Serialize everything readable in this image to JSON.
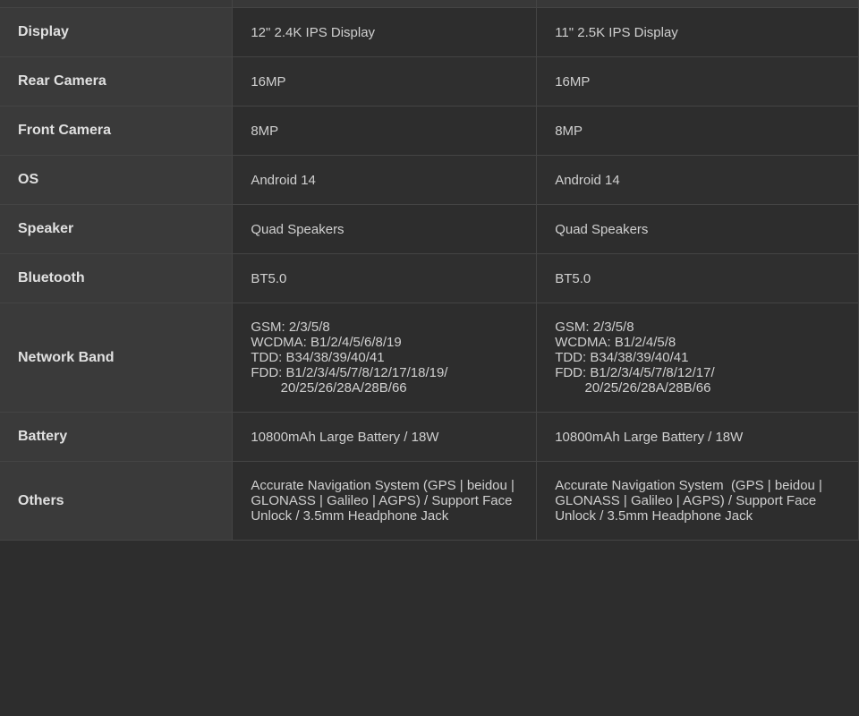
{
  "table": {
    "top_row": {
      "label": "",
      "col1": "",
      "col2": ""
    },
    "rows": [
      {
        "id": "display",
        "label": "Display",
        "col1": "12\" 2.4K IPS Display",
        "col2": "11\" 2.5K IPS Display"
      },
      {
        "id": "rear-camera",
        "label": "Rear Camera",
        "col1": "16MP",
        "col2": "16MP"
      },
      {
        "id": "front-camera",
        "label": "Front Camera",
        "col1": "8MP",
        "col2": "8MP"
      },
      {
        "id": "os",
        "label": "OS",
        "col1": "Android 14",
        "col2": "Android 14"
      },
      {
        "id": "speaker",
        "label": "Speaker",
        "col1": "Quad Speakers",
        "col2": "Quad Speakers"
      },
      {
        "id": "bluetooth",
        "label": "Bluetooth",
        "col1": "BT5.0",
        "col2": "BT5.0"
      },
      {
        "id": "network-band",
        "label": "Network Band",
        "col1": "GSM: 2/3/5/8\nWCDMA: B1/2/4/5/6/8/19\nTDD: B34/38/39/40/41\nFDD: B1/2/3/4/5/7/8/12/17/18/19/\n        20/25/26/28A/28B/66",
        "col2": "GSM: 2/3/5/8\nWCDMA: B1/2/4/5/8\nTDD: B34/38/39/40/41\nFDD: B1/2/3/4/5/7/8/12/17/\n        20/25/26/28A/28B/66"
      },
      {
        "id": "battery",
        "label": "Battery",
        "col1": "10800mAh Large Battery / 18W",
        "col2": "10800mAh Large Battery / 18W"
      },
      {
        "id": "others",
        "label": "Others",
        "col1": "Accurate Navigation System (GPS | beidou | GLONASS | Galileo | AGPS) / Support Face Unlock / 3.5mm Headphone Jack",
        "col2": "Accurate Navigation System  (GPS | beidou | GLONASS | Galileo | AGPS) / Support Face Unlock / 3.5mm Headphone Jack"
      }
    ]
  }
}
